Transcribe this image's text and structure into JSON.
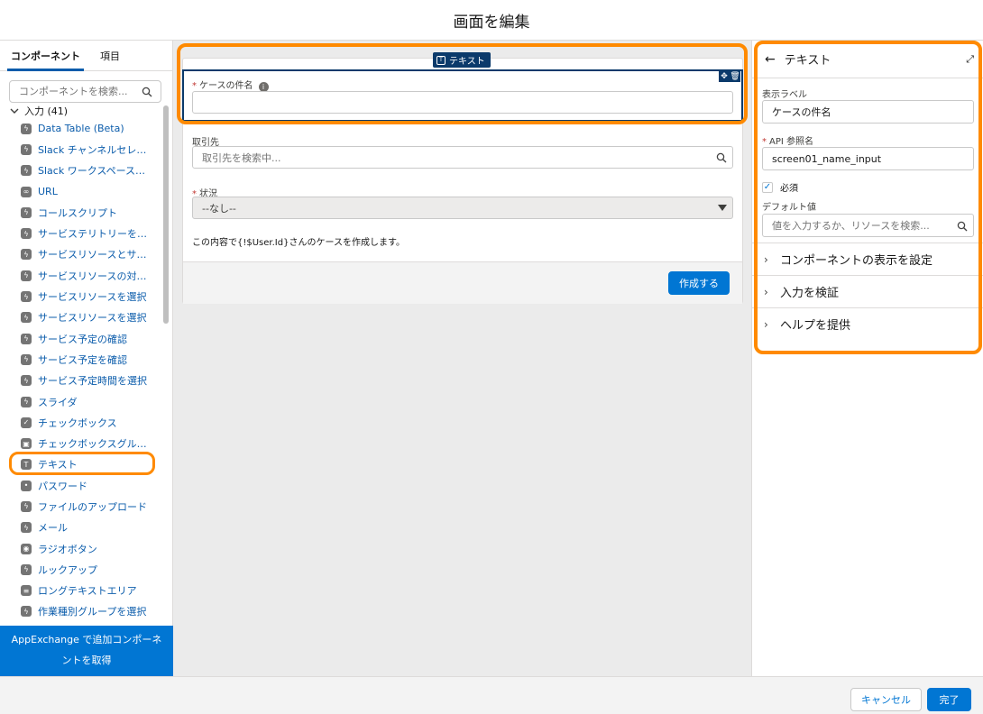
{
  "header": {
    "title": "画面を編集"
  },
  "left": {
    "tabs": [
      "コンポーネント",
      "項目"
    ],
    "search_placeholder": "コンポーネントを検索...",
    "group_label": "入力 (41)",
    "items": [
      {
        "label": "Data Table (Beta)",
        "icon": "bolt"
      },
      {
        "label": "Slack チャンネルセレクタ",
        "icon": "bolt"
      },
      {
        "label": "Slack ワークスペースセレ...",
        "icon": "bolt"
      },
      {
        "label": "URL",
        "icon": "link"
      },
      {
        "label": "コールスクリプト",
        "icon": "bolt"
      },
      {
        "label": "サービステリトリーを選択",
        "icon": "bolt"
      },
      {
        "label": "サービスリソースとサー...",
        "icon": "bolt"
      },
      {
        "label": "サービスリソースの対応...",
        "icon": "bolt"
      },
      {
        "label": "サービスリソースを選択",
        "icon": "bolt"
      },
      {
        "label": "サービスリソースを選択",
        "icon": "bolt"
      },
      {
        "label": "サービス予定の確認",
        "icon": "bolt"
      },
      {
        "label": "サービス予定を確認",
        "icon": "bolt"
      },
      {
        "label": "サービス予定時間を選択",
        "icon": "bolt"
      },
      {
        "label": "スライダ",
        "icon": "bolt"
      },
      {
        "label": "チェックボックス",
        "icon": "check"
      },
      {
        "label": "チェックボックスグループ",
        "icon": "checkgroup"
      },
      {
        "label": "テキスト",
        "icon": "text"
      },
      {
        "label": "パスワード",
        "icon": "password"
      },
      {
        "label": "ファイルのアップロード",
        "icon": "bolt"
      },
      {
        "label": "メール",
        "icon": "bolt"
      },
      {
        "label": "ラジオボタン",
        "icon": "radio"
      },
      {
        "label": "ルックアップ",
        "icon": "bolt"
      },
      {
        "label": "ロングテキストエリア",
        "icon": "textarea"
      },
      {
        "label": "作業種別グループを選択",
        "icon": "bolt"
      }
    ],
    "appexchange": "AppExchange で追加コンポーネントを取得"
  },
  "canvas": {
    "badge": "テキスト",
    "field1_label": "ケースの件名",
    "field2_label": "取引先",
    "field2_placeholder": "取引先を検索中...",
    "field3_label": "状況",
    "field3_value": "--なし--",
    "message": "この内容で{!$User.Id}さんのケースを作成します。",
    "create_button": "作成する"
  },
  "right": {
    "title": "テキスト",
    "display_label": "表示ラベル",
    "display_value": "ケースの件名",
    "api_label": "API 参照名",
    "api_value": "screen01_name_input",
    "required_label": "必須",
    "default_label": "デフォルト値",
    "default_placeholder": "値を入力するか、リソースを検索...",
    "sections": [
      "コンポーネントの表示を設定",
      "入力を検証",
      "ヘルプを提供"
    ]
  },
  "footer": {
    "cancel": "キャンセル",
    "done": "完了"
  },
  "colors": {
    "brand": "#0176d3",
    "highlight": "#ff8a00",
    "selected": "#0b3a6b"
  }
}
